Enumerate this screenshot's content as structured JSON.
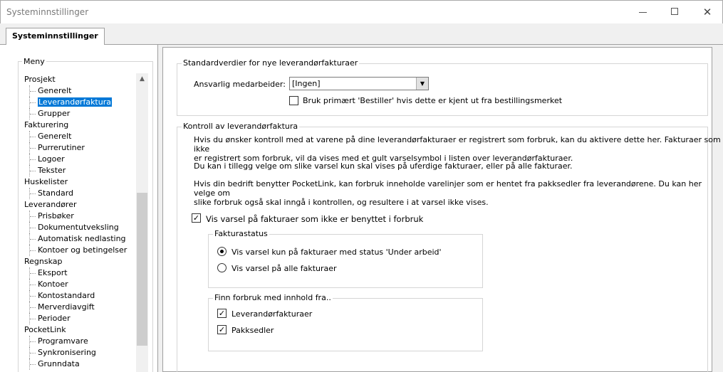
{
  "window": {
    "title": "Systeminnstillinger"
  },
  "tab": {
    "label": "Systeminnstillinger"
  },
  "menu": {
    "legend": "Meny",
    "tree": [
      {
        "label": "Prosjekt",
        "level": 0
      },
      {
        "label": "Generelt",
        "level": 1
      },
      {
        "label": "Leverandørfaktura",
        "level": 1,
        "selected": true
      },
      {
        "label": "Grupper",
        "level": 1
      },
      {
        "label": "Fakturering",
        "level": 0
      },
      {
        "label": "Generelt",
        "level": 1
      },
      {
        "label": "Purrerutiner",
        "level": 1
      },
      {
        "label": "Logoer",
        "level": 1
      },
      {
        "label": "Tekster",
        "level": 1
      },
      {
        "label": "Huskelister",
        "level": 0
      },
      {
        "label": "Standard",
        "level": 1
      },
      {
        "label": "Leverandører",
        "level": 0
      },
      {
        "label": "Prisbøker",
        "level": 1
      },
      {
        "label": "Dokumentutveksling",
        "level": 1
      },
      {
        "label": "Automatisk nedlasting",
        "level": 1
      },
      {
        "label": "Kontoer og betingelser",
        "level": 1
      },
      {
        "label": "Regnskap",
        "level": 0
      },
      {
        "label": "Eksport",
        "level": 1
      },
      {
        "label": "Kontoer",
        "level": 1
      },
      {
        "label": "Kontostandard",
        "level": 1
      },
      {
        "label": "Merverdiavgift",
        "level": 1
      },
      {
        "label": "Perioder",
        "level": 1
      },
      {
        "label": "PocketLink",
        "level": 0
      },
      {
        "label": "Programvare",
        "level": 1
      },
      {
        "label": "Synkronisering",
        "level": 1
      },
      {
        "label": "Grunndata",
        "level": 1
      }
    ]
  },
  "defaults": {
    "legend": "Standardverdier for nye leverandørfakturaer",
    "responsible_label": "Ansvarlig medarbeider:",
    "responsible_value": "[Ingen]",
    "orderer_checkbox": {
      "label": "Bruk primært 'Bestiller' hvis dette er kjent ut fra bestillingsmerket",
      "checked": false
    }
  },
  "control": {
    "legend": "Kontroll av leverandørfaktura",
    "para1_line1": "Hvis du ønsker kontroll med at varene på dine leverandørfakturaer er registrert som forbruk, kan du aktivere dette her. Fakturaer som ikke",
    "para1_line2": "er registrert som forbruk, vil da vises med et gult varselsymbol i listen over leverandørfakturaer.",
    "para2": "Du kan i tillegg velge om slike varsel kun skal vises på uferdige fakturaer, eller på alle fakturaer.",
    "para3_line1": "Hvis din bedrift benytter PocketLink, kan forbruk inneholde varelinjer som er hentet fra pakksedler fra leverandørene. Du kan her velge om",
    "para3_line2": "slike forbruk også skal inngå i kontrollen, og resultere i at varsel ikke vises.",
    "warn_checkbox": {
      "label": "Vis varsel på fakturaer som ikke er benyttet i forbruk",
      "checked": true
    },
    "status": {
      "legend": "Fakturastatus",
      "option1": "Vis varsel kun på fakturaer med status 'Under arbeid'",
      "option2": "Vis varsel på alle fakturaer",
      "selected": 1
    },
    "find": {
      "legend": "Finn forbruk med innhold fra..",
      "cb1": {
        "label": "Leverandørfakturaer",
        "checked": true
      },
      "cb2": {
        "label": "Pakksedler",
        "checked": true
      }
    }
  }
}
